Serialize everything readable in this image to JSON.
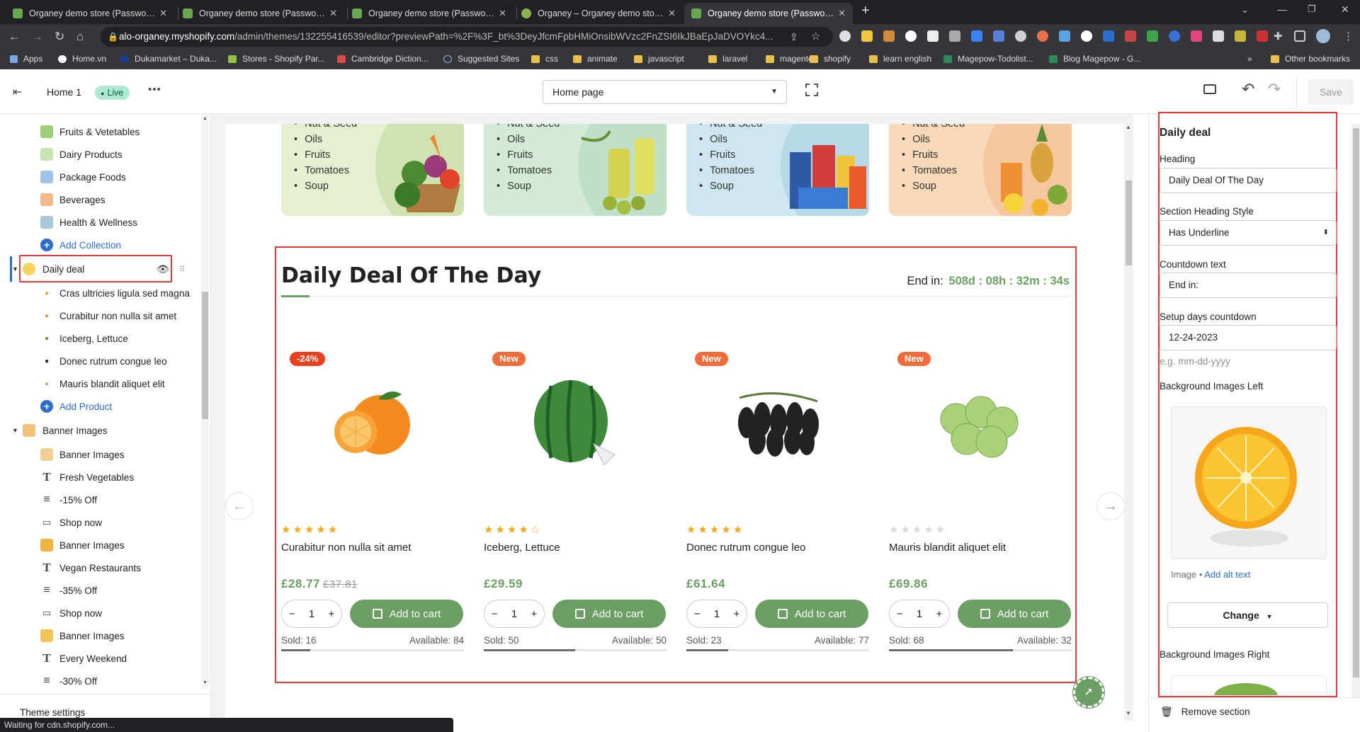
{
  "browser": {
    "tabs": [
      {
        "title": "Organey demo store (Password: ..."
      },
      {
        "title": "Organey demo store (Password: ..."
      },
      {
        "title": "Organey demo store (Password: ..."
      },
      {
        "title": "Organey – Organey demo store ..."
      },
      {
        "title": "Organey demo store (Password: ..."
      }
    ],
    "url_host": "alo-organey.myshopify.com",
    "url_path": "/admin/themes/132255416539/editor?previewPath=%2F%3F_bt%3DeyJfcmFpbHMiOnsibWVzc2FnZSI6IkJBaEpJaDVOYkc4...",
    "bookmarks": [
      "Apps",
      "Home.vn",
      "Dukamarket – Duka...",
      "Stores - Shopify Par...",
      "Cambridge Diction...",
      "Suggested Sites",
      "css",
      "animate",
      "javascript",
      "laravel",
      "magento",
      "shopify",
      "learn english",
      "Magepow-Todolist...",
      "Blog Magepow - G..."
    ],
    "bookmarks_more": "»",
    "other_bookmarks": "Other bookmarks",
    "status": "Waiting for cdn.shopify.com..."
  },
  "editor": {
    "theme_name": "Home 1",
    "live_badge": "Live",
    "more": "•••",
    "page_select": "Home page",
    "save": "Save"
  },
  "sidebar": {
    "items": [
      {
        "label": "Fruits & Vetetables"
      },
      {
        "label": "Dairy Products"
      },
      {
        "label": "Package Foods"
      },
      {
        "label": "Beverages"
      },
      {
        "label": "Health & Wellness"
      },
      {
        "label": "Add Collection"
      },
      {
        "label": "Daily deal"
      },
      {
        "label": "Cras ultricies ligula sed magna"
      },
      {
        "label": "Curabitur non nulla sit amet"
      },
      {
        "label": "Iceberg, Lettuce"
      },
      {
        "label": "Donec rutrum congue leo"
      },
      {
        "label": "Mauris blandit aliquet elit"
      },
      {
        "label": "Add Product"
      },
      {
        "label": "Banner Images"
      },
      {
        "label": "Banner Images"
      },
      {
        "label": "Fresh Vegetables"
      },
      {
        "label": "-15% Off"
      },
      {
        "label": "Shop now"
      },
      {
        "label": "Banner Images"
      },
      {
        "label": "Vegan Restaurants"
      },
      {
        "label": "-35% Off"
      },
      {
        "label": "Shop now"
      },
      {
        "label": "Banner Images"
      },
      {
        "label": "Every Weekend"
      },
      {
        "label": "-30% Off"
      }
    ],
    "theme_settings": "Theme settings"
  },
  "preview": {
    "category_list": [
      "Nut & Seed",
      "Oils",
      "Fruits",
      "Tomatoes",
      "Soup"
    ],
    "deal_title": "Daily Deal Of The Day",
    "end_label": "End in:",
    "countdown": "508d : 08h : 32m : 34s",
    "products": [
      {
        "badge": "-24%",
        "name": "Curabitur non nulla sit amet",
        "price": "£28.77",
        "old_price": "£37.81",
        "rating": 5,
        "qty": "1",
        "sold": "Sold: 16",
        "available": "Available: 84",
        "sold_fraction": 0.16
      },
      {
        "badge": "New",
        "name": "Iceberg, Lettuce",
        "price": "£29.59",
        "old_price": "",
        "rating": 4.5,
        "qty": "1",
        "sold": "Sold: 50",
        "available": "Available: 50",
        "sold_fraction": 0.5
      },
      {
        "badge": "New",
        "name": "Donec rutrum congue leo",
        "price": "£61.64",
        "old_price": "",
        "rating": 5,
        "qty": "1",
        "sold": "Sold: 23",
        "available": "Available: 77",
        "sold_fraction": 0.23
      },
      {
        "badge": "New",
        "name": "Mauris blandit aliquet elit",
        "price": "£69.86",
        "old_price": "",
        "rating": 0,
        "qty": "1",
        "sold": "Sold: 68",
        "available": "Available: 32",
        "sold_fraction": 0.68
      }
    ],
    "add_to_cart": "Add to cart"
  },
  "settings": {
    "section_title": "Daily deal",
    "heading_label": "Heading",
    "heading_value": "Daily Deal Of The Day",
    "heading_style_label": "Section Heading Style",
    "heading_style_value": "Has Underline",
    "countdown_text_label": "Countdown text",
    "countdown_text_value": "End in:",
    "days_label": "Setup days countdown",
    "days_value": "12-24-2023",
    "days_hint": "e.g. mm-dd-yyyy",
    "bg_left_label": "Background Images Left",
    "image_caption": "Image",
    "add_alt": "Add alt text",
    "change": "Change",
    "bg_right_label": "Background Images Right",
    "remove": "Remove section"
  },
  "colors": {
    "brand_green": "#6a9e63",
    "badge_red": "#e9401d",
    "badge_orange": "#f06b3a",
    "selection_red": "#e53b3b",
    "link_blue": "#2c6ecb"
  }
}
